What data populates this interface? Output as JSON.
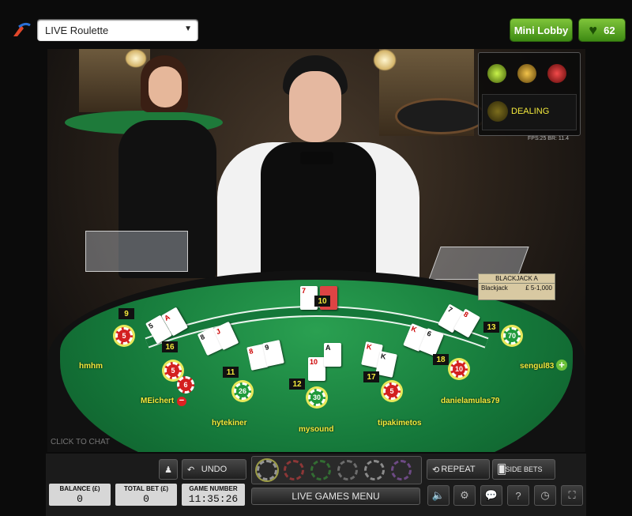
{
  "header": {
    "game_select_value": "LIVE Roulette",
    "mini_lobby_label": "Mini Lobby",
    "favourites_count": "62",
    "icons": {
      "logo": "swoosh-logo-icon",
      "dropdown": "chevron-down-icon",
      "favourites": "heart-icon"
    }
  },
  "video": {
    "status": {
      "dealing_label": "DEALING",
      "lights": [
        "green",
        "amber",
        "red"
      ],
      "stats_line": "FPS:25 BR: 11.4"
    },
    "limits": {
      "title": "BLACKJACK A",
      "game": "Blackjack",
      "range": "£ 5-1,000"
    },
    "dealer_card_count": "10",
    "click_to_chat": "CLICK TO CHAT",
    "seats": [
      {
        "seat_label": "9",
        "chip_value": "5",
        "player": "hmhm"
      },
      {
        "seat_label": "16",
        "chip_value": "5",
        "chip_value_2": "6",
        "player": "MEichert"
      },
      {
        "seat_label": "11",
        "chip_value": "26",
        "player": "hytekiner"
      },
      {
        "seat_label": "12",
        "chip_value": "30",
        "player": "mysound"
      },
      {
        "seat_label": "17",
        "chip_value": "5",
        "player": "tipakimetos"
      },
      {
        "seat_label": "18",
        "chip_value": "10",
        "player": "danielamulas79"
      },
      {
        "seat_label": "13",
        "chip_value": "70",
        "player": "sengul83"
      }
    ]
  },
  "controls": {
    "undo_label": "UNDO",
    "repeat_label": "REPEAT",
    "side_bets_label": "SIDE BETS",
    "live_games_menu_label": "LIVE GAMES MENU",
    "balance": {
      "label": "BALANCE (£)",
      "value": "0"
    },
    "total_bet": {
      "label": "TOTAL BET (£)",
      "value": "0"
    },
    "game_number": {
      "label": "GAME NUMBER",
      "value": "11:35:26"
    },
    "bottom_icons": [
      "volume-icon",
      "settings-icon",
      "chat-icon",
      "help-icon",
      "history-icon",
      "fullscreen-icon"
    ]
  },
  "colors": {
    "accent_green": "#5ea627",
    "felt": "#15783a",
    "player_name": "#f4ea3c"
  }
}
